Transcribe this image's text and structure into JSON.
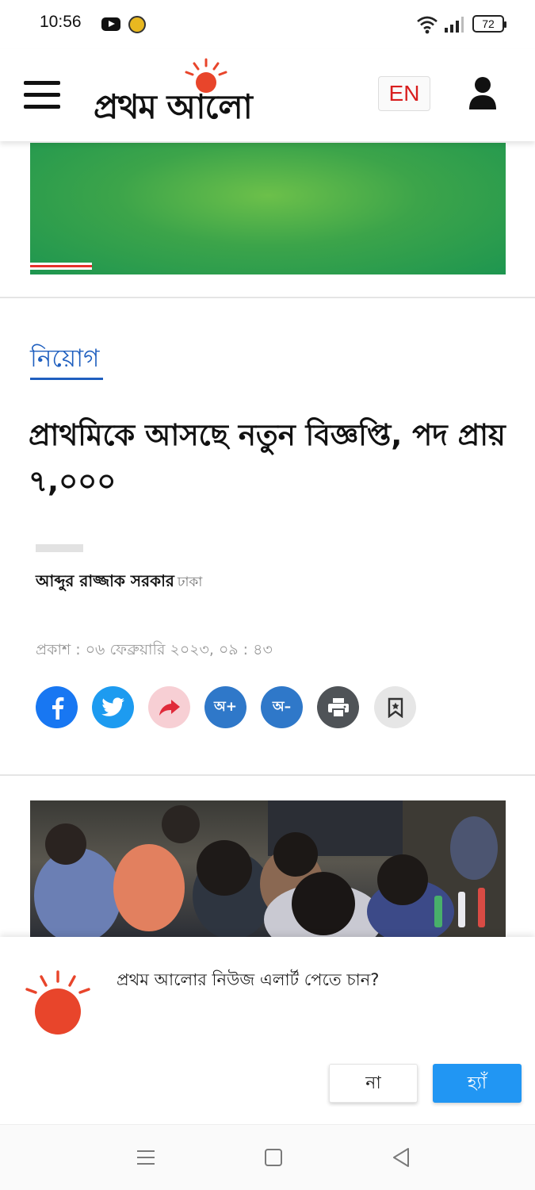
{
  "status_bar": {
    "time": "10:56",
    "battery": "72",
    "icons": [
      "youtube-icon",
      "app-notification-icon",
      "wifi-icon",
      "signal-icon",
      "battery-icon"
    ]
  },
  "header": {
    "logo_text": "প্রথম আলো",
    "language_button": "EN",
    "icons": [
      "menu-icon",
      "user-icon"
    ],
    "colors": {
      "logo_sun": "#e8452b",
      "language_text": "#d81e1e"
    }
  },
  "article": {
    "category": "নিয়োগ",
    "title": "প্রাথমিকে আসছে নতুন বিজ্ঞপ্তি, পদ প্রায় ৭,০০০",
    "author": "আব্দুর রাজ্জাক সরকার",
    "location": "ঢাকা",
    "published": "প্রকাশ : ০৬ ফেব্রুয়ারি ২০২৩, ০৯ : ৪৩",
    "share_buttons": [
      {
        "icon": "facebook-icon",
        "color": "#1877f2"
      },
      {
        "icon": "twitter-icon",
        "color": "#1d9bf0"
      },
      {
        "icon": "share-icon",
        "color": "#f7cfd4"
      },
      {
        "label": "অ+",
        "icon": "font-increase-icon",
        "color": "#2f78c9"
      },
      {
        "label": "অ–",
        "icon": "font-decrease-icon",
        "color": "#2f78c9"
      },
      {
        "icon": "print-icon",
        "color": "#4f5357"
      },
      {
        "icon": "bookmark-icon",
        "color": "#e6e6e6"
      }
    ],
    "category_color": "#1f5fbf"
  },
  "notification_prompt": {
    "question": "প্রথম আলোর নিউজ এলার্ট পেতে চান?",
    "no_label": "না",
    "yes_label": "হ্যাঁ",
    "yes_color": "#2196f3"
  },
  "navigation_bar": {
    "icons": [
      "recent-apps-icon",
      "home-icon",
      "back-icon"
    ]
  }
}
